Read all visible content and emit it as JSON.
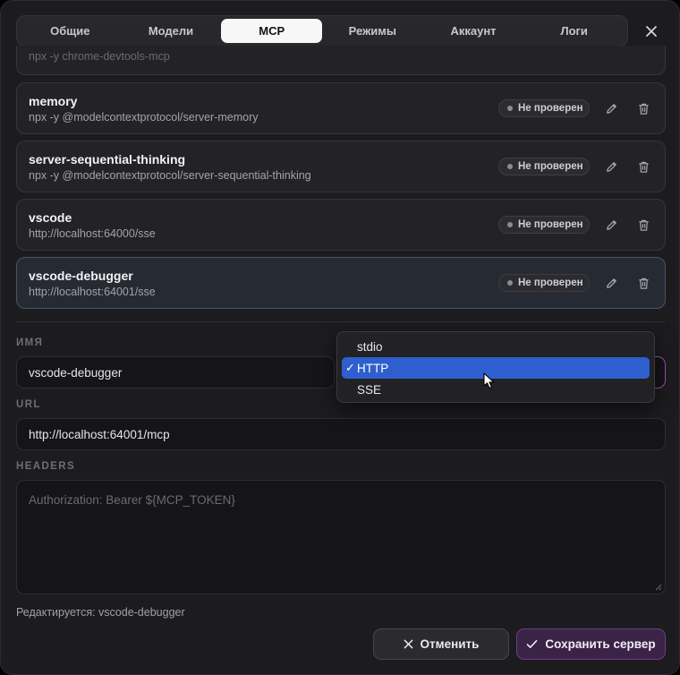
{
  "tabs": [
    {
      "label": "Общие",
      "active": false
    },
    {
      "label": "Модели",
      "active": false
    },
    {
      "label": "MCP",
      "active": true
    },
    {
      "label": "Режимы",
      "active": false
    },
    {
      "label": "Аккаунт",
      "active": false
    },
    {
      "label": "Логи",
      "active": false
    }
  ],
  "partial_server": {
    "cmd": "npx -y chrome-devtools-mcp"
  },
  "servers": [
    {
      "name": "memory",
      "cmd": "npx -y @modelcontextprotocol/server-memory",
      "status": "Не проверен"
    },
    {
      "name": "server-sequential-thinking",
      "cmd": "npx -y @modelcontextprotocol/server-sequential-thinking",
      "status": "Не проверен"
    },
    {
      "name": "vscode",
      "cmd": "http://localhost:64000/sse",
      "status": "Не проверен"
    },
    {
      "name": "vscode-debugger",
      "cmd": "http://localhost:64001/sse",
      "status": "Не проверен",
      "selected": true
    }
  ],
  "form": {
    "name_label": "ИМЯ",
    "name_value": "vscode-debugger",
    "url_label": "URL",
    "url_value": "http://localhost:64001/mcp",
    "headers_label": "HEADERS",
    "headers_placeholder": "Authorization: Bearer ${MCP_TOKEN}",
    "transport_options": [
      "stdio",
      "HTTP",
      "SSE"
    ],
    "transport_selected": "HTTP",
    "check_mark": "✓"
  },
  "footer": {
    "editing_note": "Редактируется: vscode-debugger",
    "cancel_label": "Отменить",
    "save_label": "Сохранить сервер"
  },
  "colors": {
    "accent_select": "#2f5fce",
    "save_button": "#3a2347",
    "focus_ring": "#a34fb5"
  }
}
